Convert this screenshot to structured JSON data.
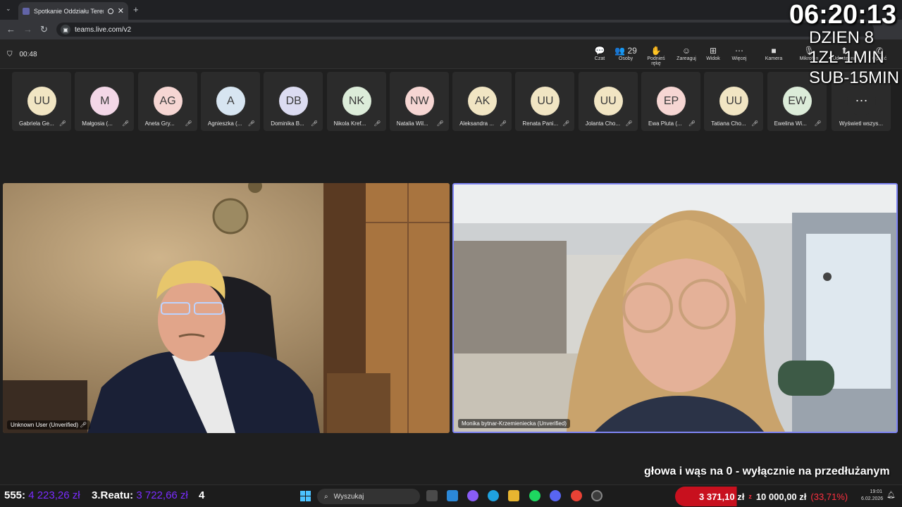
{
  "browser": {
    "tab_title": "Spotkanie Oddziału Terenow...",
    "new_tab": "+",
    "url": "teams.live.com/v2"
  },
  "meeting": {
    "elapsed": "00:48",
    "tools": [
      {
        "label": "Czat",
        "icon": "chat-icon",
        "glyph": "💬"
      },
      {
        "label": "Osoby",
        "icon": "people-icon",
        "glyph": "👥",
        "badge": "29"
      },
      {
        "label": "Podnieś rękę",
        "icon": "hand-icon",
        "glyph": "✋"
      },
      {
        "label": "Zareaguj",
        "icon": "smile-icon",
        "glyph": "☺"
      },
      {
        "label": "Widok",
        "icon": "grid-icon",
        "glyph": "⊞"
      },
      {
        "label": "Więcej",
        "icon": "more-icon",
        "glyph": "⋯"
      },
      {
        "label": "Kamera",
        "icon": "camera-icon",
        "glyph": "■"
      },
      {
        "label": "Mikrofon",
        "icon": "mic-icon",
        "glyph": "🎙"
      },
      {
        "label": "Udostępnij",
        "icon": "share-icon",
        "glyph": "⬆"
      },
      {
        "label": "Opuść",
        "icon": "leave-icon",
        "glyph": "✆"
      }
    ]
  },
  "participants": [
    {
      "initials": "UU",
      "name": "Gabriela Ge...",
      "color": "#f1e5c3"
    },
    {
      "initials": "M",
      "name": "Małgosia (...",
      "color": "#f3d7e7"
    },
    {
      "initials": "AG",
      "name": "Aneta Gry...",
      "color": "#f6d6d3"
    },
    {
      "initials": "A",
      "name": "Agnieszka (...",
      "color": "#d7e5f1"
    },
    {
      "initials": "DB",
      "name": "Dominika B...",
      "color": "#dcdcf1"
    },
    {
      "initials": "NK",
      "name": "Nikola Kref...",
      "color": "#dcecd9"
    },
    {
      "initials": "NW",
      "name": "Natalia Wil...",
      "color": "#f6d6d3"
    },
    {
      "initials": "AK",
      "name": "Aleksandra ...",
      "color": "#f1e5c3"
    },
    {
      "initials": "UU",
      "name": "Renata Pani...",
      "color": "#f1e5c3"
    },
    {
      "initials": "UU",
      "name": "Jolanta Cho...",
      "color": "#f1e5c3"
    },
    {
      "initials": "EP",
      "name": "Ewa Pluta (...",
      "color": "#f6d6d3"
    },
    {
      "initials": "UU",
      "name": "Tatiana Cho...",
      "color": "#f1e5c3"
    },
    {
      "initials": "EW",
      "name": "Ewelina Wi...",
      "color": "#dcecd9"
    }
  ],
  "show_all": {
    "label": "Wyświetl wszys...",
    "glyph": "⋯"
  },
  "videos": [
    {
      "label": "Unknown User (Unverified)"
    },
    {
      "label": "Monika bytnar-Krzemieniecka (Unverified)"
    }
  ],
  "overlay": {
    "clock": "06:20:13",
    "day": "DZIEN 8",
    "rate1": "1ZŁ-1MIN",
    "rate2": "SUB-15MIN",
    "ticker": "głowa i wąs na 0 - wyłącznie na przedłużanym"
  },
  "taskbar": {
    "stat1_label": "555:",
    "stat1_value": "4 223,26 zł",
    "stat2_label": "3.Reatu:",
    "stat2_value": "3 722,66 zł",
    "stat3": "4",
    "search_placeholder": "Wyszukaj",
    "goal_current": "3 371,10 zł",
    "goal_sep": "z",
    "goal_target": "10 000,00 zł",
    "goal_percent": "(33,71%)",
    "goal_fill_percent": 33.71,
    "time": "19:01",
    "date": "6.02.2026"
  }
}
